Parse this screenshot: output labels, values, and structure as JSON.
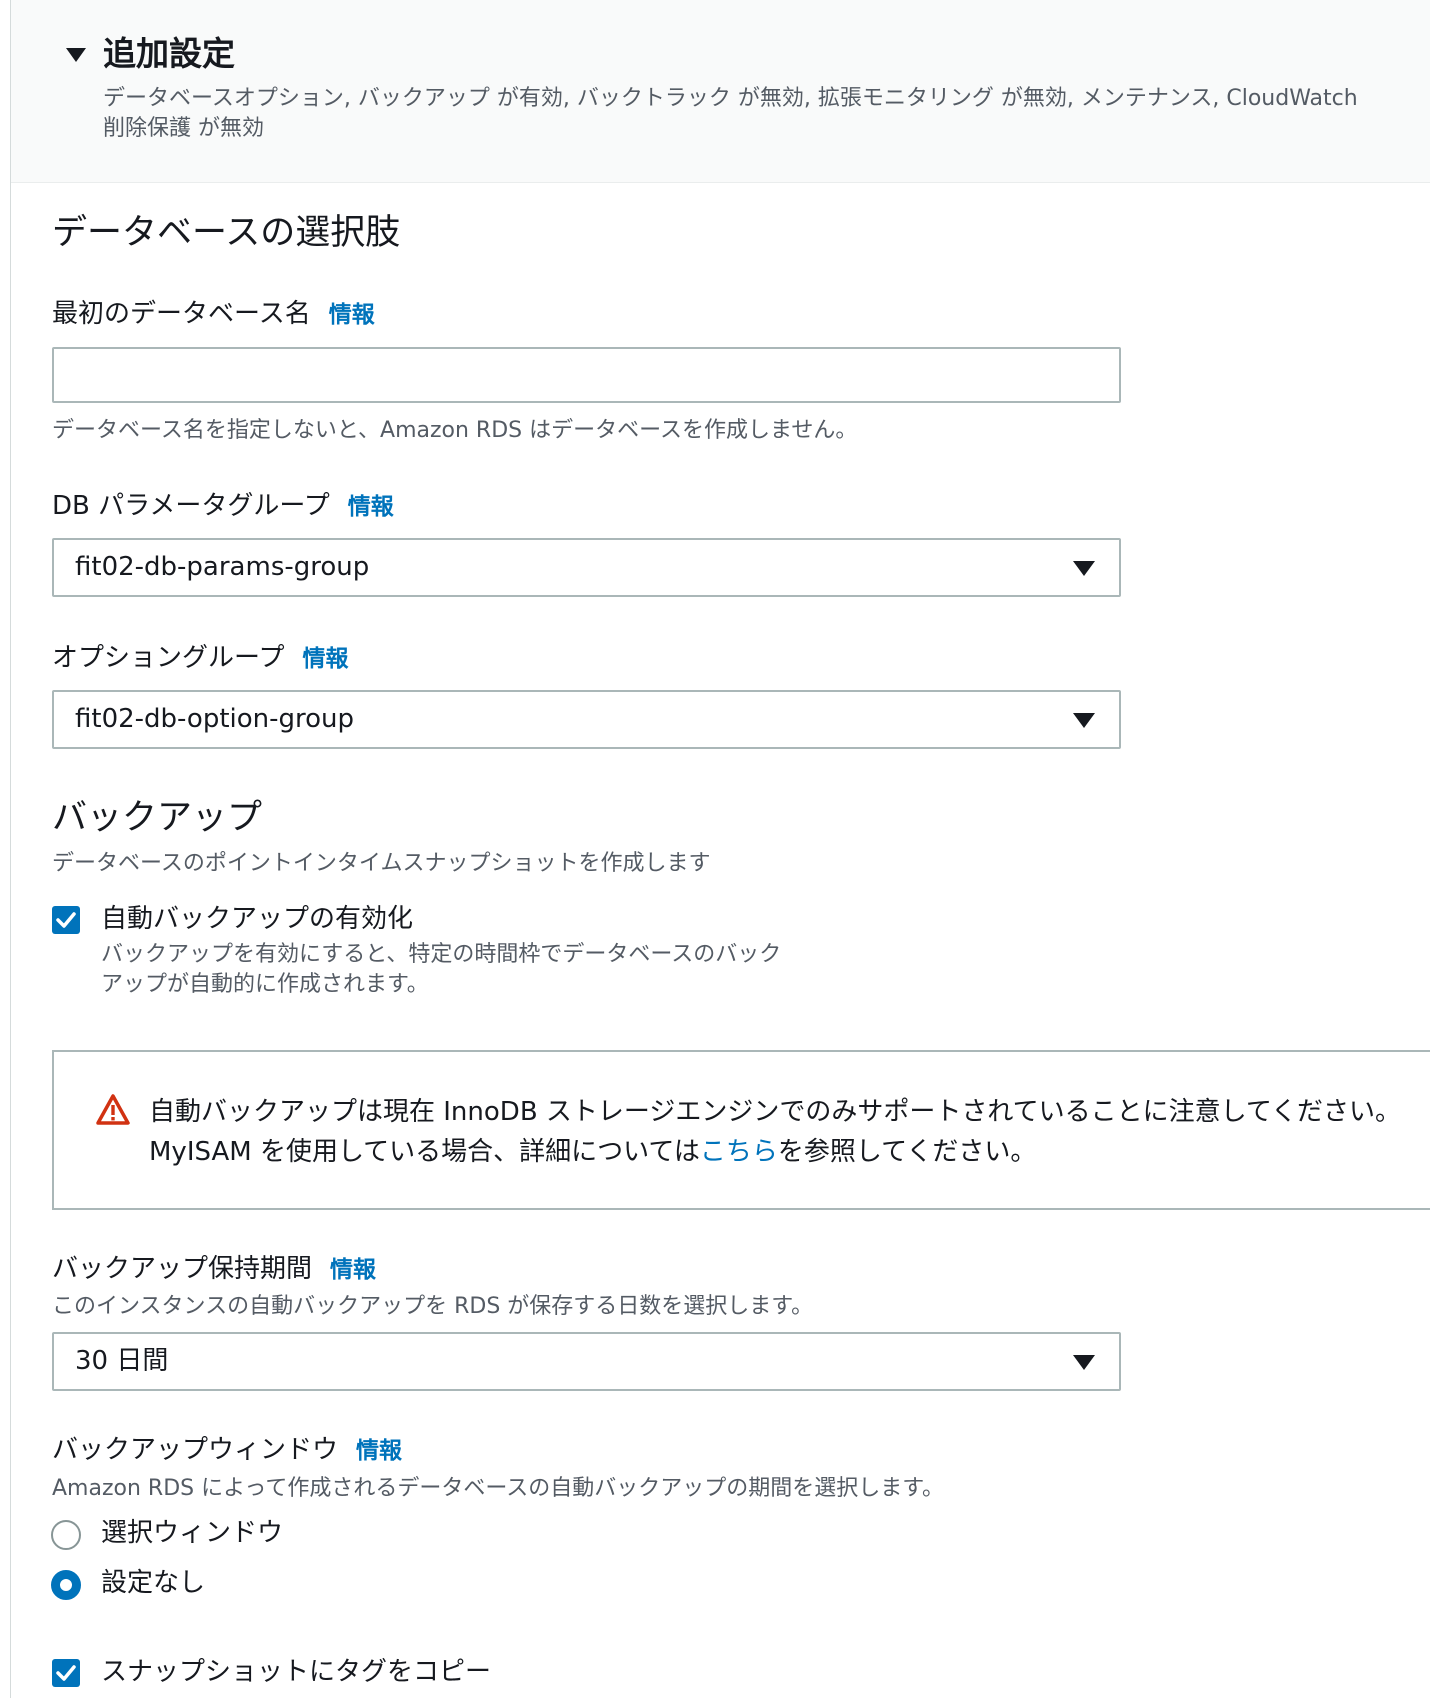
{
  "header": {
    "title": "追加設定",
    "summary": "データベースオプション, バックアップ が有効, バックトラック が無効, 拡張モニタリング が無効, メンテナンス, CloudWatch\n削除保護 が無効"
  },
  "db_options": {
    "title": "データベースの選択肢",
    "initial_db_name": {
      "label": "最初のデータベース名",
      "info": "情報",
      "value": "",
      "hint": "データベース名を指定しないと、Amazon RDS はデータベースを作成しません。"
    },
    "param_group": {
      "label": "DB パラメータグループ",
      "info": "情報",
      "value": "fit02-db-params-group"
    },
    "option_group": {
      "label": "オプショングループ",
      "info": "情報",
      "value": "fit02-db-option-group"
    }
  },
  "backup": {
    "title": "バックアップ",
    "description": "データベースのポイントインタイムスナップショットを作成します",
    "auto_backup": {
      "label": "自動バックアップの有効化",
      "checked": true,
      "description": "バックアップを有効にすると、特定の時間枠でデータベースのバック\nアップが自動的に作成されます。"
    },
    "alert": {
      "text_before": "自動バックアップは現在 InnoDB ストレージエンジンでのみサポートされていることに注意してください。MyISAM を使用している場合、詳細については",
      "link": "こちら",
      "text_after": "を参照してください。"
    },
    "retention": {
      "label": "バックアップ保持期間",
      "info": "情報",
      "hint": "このインスタンスの自動バックアップを RDS が保存する日数を選択します。",
      "value": "30 日間"
    },
    "window": {
      "label": "バックアップウィンドウ",
      "info": "情報",
      "hint": "Amazon RDS によって作成されるデータベースの自動バックアップの期間を選択します。",
      "options": [
        {
          "label": "選択ウィンドウ",
          "selected": false
        },
        {
          "label": "設定なし",
          "selected": true
        }
      ]
    },
    "copy_tags": {
      "label": "スナップショットにタグをコピー",
      "checked": true
    }
  },
  "colors": {
    "accent": "#0073bb",
    "warning": "#d13212",
    "text": "#16191f",
    "muted": "#545b64",
    "border": "#aab7b8"
  }
}
